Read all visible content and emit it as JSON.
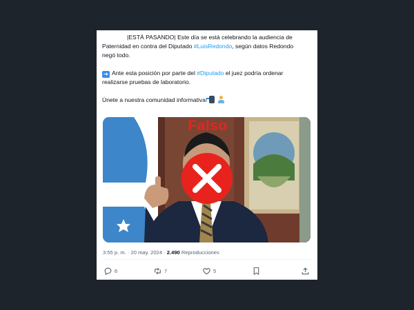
{
  "tweet": {
    "lines": [
      "|ESTÁ PASANDO| Este día se está celebrando la audiencia de",
      "Paternidad en contra del Diputado ",
      "#LuisRedondo",
      ", según datos Redondo",
      "negó todo.",
      "Ante esta posición por parte del ",
      "#Diputado",
      " el juez podría ordenar",
      "realizarse pruebas de laboratorio.",
      "Únete a nuestra comunidad informativa!"
    ],
    "overlay_label": "Falso",
    "time": "3:55 p. m.",
    "date": "20 may. 2024",
    "views_count": "2.490",
    "views_label": "Reproducciones",
    "replies": "6",
    "retweets": "7",
    "likes": "5"
  },
  "colors": {
    "background": "#1e242b",
    "link": "#1d9bf0",
    "verdict_red": "#e8231e",
    "muted": "#536471"
  },
  "icons": [
    "right-arrow-emoji-icon",
    "phone-emoji-icon",
    "person-emoji-icon",
    "false-x-icon",
    "reply-icon",
    "retweet-icon",
    "like-icon",
    "bookmark-icon",
    "share-icon"
  ]
}
